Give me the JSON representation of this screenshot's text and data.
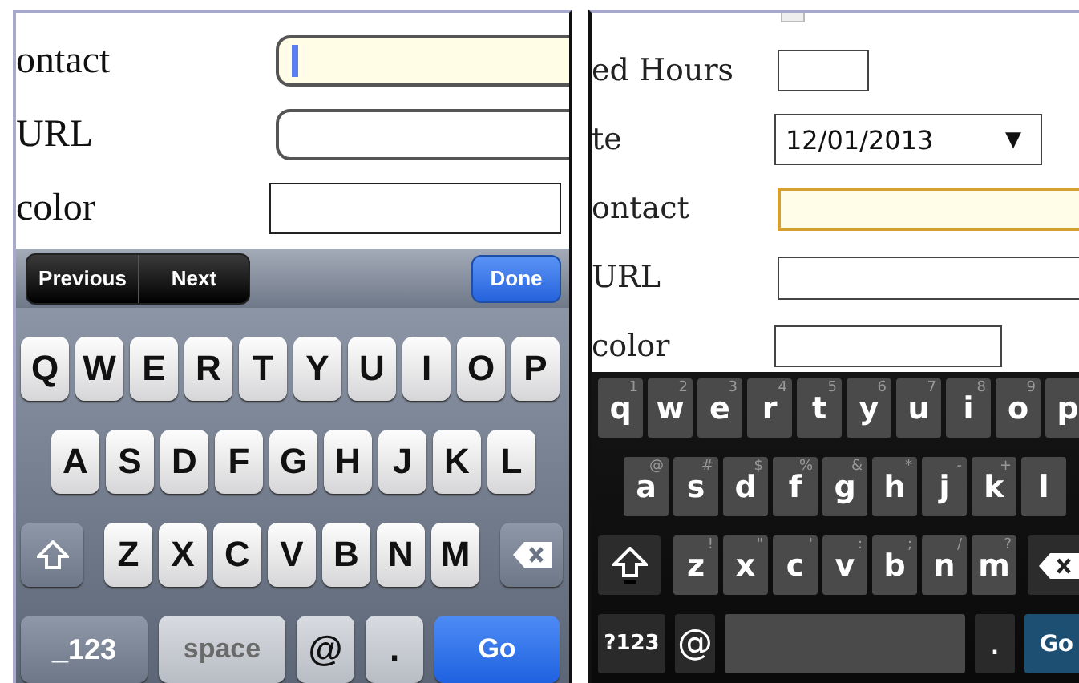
{
  "ios_screen": {
    "form": {
      "rows": [
        {
          "label": "ontact",
          "kind": "text",
          "focused": true
        },
        {
          "label": "URL",
          "kind": "text",
          "focused": false
        },
        {
          "label": "color",
          "kind": "color",
          "focused": false
        }
      ]
    },
    "form_toolbar": {
      "previous": "Previous",
      "next": "Next",
      "done": "Done"
    },
    "keyboard": {
      "rows": [
        {
          "keys": [
            {
              "kind": "letter",
              "label": "Q"
            },
            {
              "kind": "letter",
              "label": "W"
            },
            {
              "kind": "letter",
              "label": "E"
            },
            {
              "kind": "letter",
              "label": "R"
            },
            {
              "kind": "letter",
              "label": "T"
            },
            {
              "kind": "letter",
              "label": "Y"
            },
            {
              "kind": "letter",
              "label": "U"
            },
            {
              "kind": "letter",
              "label": "I"
            },
            {
              "kind": "letter",
              "label": "O"
            },
            {
              "kind": "letter",
              "label": "P"
            }
          ]
        },
        {
          "keys": [
            {
              "kind": "letter",
              "label": "A"
            },
            {
              "kind": "letter",
              "label": "S"
            },
            {
              "kind": "letter",
              "label": "D"
            },
            {
              "kind": "letter",
              "label": "F"
            },
            {
              "kind": "letter",
              "label": "G"
            },
            {
              "kind": "letter",
              "label": "H"
            },
            {
              "kind": "letter",
              "label": "J"
            },
            {
              "kind": "letter",
              "label": "K"
            },
            {
              "kind": "letter",
              "label": "L"
            }
          ]
        },
        {
          "keys": [
            {
              "kind": "shift"
            },
            {
              "kind": "letter",
              "label": "Z"
            },
            {
              "kind": "letter",
              "label": "X"
            },
            {
              "kind": "letter",
              "label": "C"
            },
            {
              "kind": "letter",
              "label": "V"
            },
            {
              "kind": "letter",
              "label": "B"
            },
            {
              "kind": "letter",
              "label": "N"
            },
            {
              "kind": "letter",
              "label": "M"
            },
            {
              "kind": "backspace"
            }
          ]
        },
        {
          "keys": [
            {
              "kind": "mode",
              "label": "_123"
            },
            {
              "kind": "space",
              "label": "space"
            },
            {
              "kind": "symbol",
              "label": "@"
            },
            {
              "kind": "symbol",
              "label": "."
            },
            {
              "kind": "go",
              "label": "Go"
            }
          ]
        }
      ]
    }
  },
  "android_screen": {
    "top_checkbox": {
      "checked": false
    },
    "form": {
      "rows": [
        {
          "label": "ed Hours",
          "kind": "number",
          "focused": false
        },
        {
          "label": "te",
          "kind": "select",
          "value": "12/01/2013",
          "arrow": "▼",
          "focused": false
        },
        {
          "label": "ontact",
          "kind": "text",
          "focused": true
        },
        {
          "label": "URL",
          "kind": "text",
          "focused": false
        },
        {
          "label": "color",
          "kind": "color",
          "focused": false
        }
      ]
    },
    "keyboard": {
      "rows": [
        {
          "keys": [
            {
              "kind": "letter",
              "label": "q",
              "hint": "1"
            },
            {
              "kind": "letter",
              "label": "w",
              "hint": "2"
            },
            {
              "kind": "letter",
              "label": "e",
              "hint": "3"
            },
            {
              "kind": "letter",
              "label": "r",
              "hint": "4"
            },
            {
              "kind": "letter",
              "label": "t",
              "hint": "5"
            },
            {
              "kind": "letter",
              "label": "y",
              "hint": "6"
            },
            {
              "kind": "letter",
              "label": "u",
              "hint": "7"
            },
            {
              "kind": "letter",
              "label": "i",
              "hint": "8"
            },
            {
              "kind": "letter",
              "label": "o",
              "hint": "9"
            },
            {
              "kind": "letter",
              "label": "p"
            }
          ]
        },
        {
          "keys": [
            {
              "kind": "letter",
              "label": "a",
              "hint": "@"
            },
            {
              "kind": "letter",
              "label": "s",
              "hint": "#"
            },
            {
              "kind": "letter",
              "label": "d",
              "hint": "$"
            },
            {
              "kind": "letter",
              "label": "f",
              "hint": "%"
            },
            {
              "kind": "letter",
              "label": "g",
              "hint": "&"
            },
            {
              "kind": "letter",
              "label": "h",
              "hint": "*"
            },
            {
              "kind": "letter",
              "label": "j",
              "hint": "-"
            },
            {
              "kind": "letter",
              "label": "k",
              "hint": "+"
            },
            {
              "kind": "letter",
              "label": "l"
            }
          ]
        },
        {
          "keys": [
            {
              "kind": "shift"
            },
            {
              "kind": "letter",
              "label": "z",
              "hint": "!"
            },
            {
              "kind": "letter",
              "label": "x",
              "hint": "\""
            },
            {
              "kind": "letter",
              "label": "c",
              "hint": "'"
            },
            {
              "kind": "letter",
              "label": "v",
              "hint": ":"
            },
            {
              "kind": "letter",
              "label": "b",
              "hint": ";"
            },
            {
              "kind": "letter",
              "label": "n",
              "hint": "/"
            },
            {
              "kind": "letter",
              "label": "m",
              "hint": "?"
            },
            {
              "kind": "backspace"
            }
          ]
        },
        {
          "keys": [
            {
              "kind": "mode",
              "label": "?123"
            },
            {
              "kind": "symbol",
              "label": "@"
            },
            {
              "kind": "space"
            },
            {
              "kind": "symbol",
              "label": "."
            },
            {
              "kind": "go",
              "label": "Go"
            }
          ]
        }
      ]
    }
  }
}
